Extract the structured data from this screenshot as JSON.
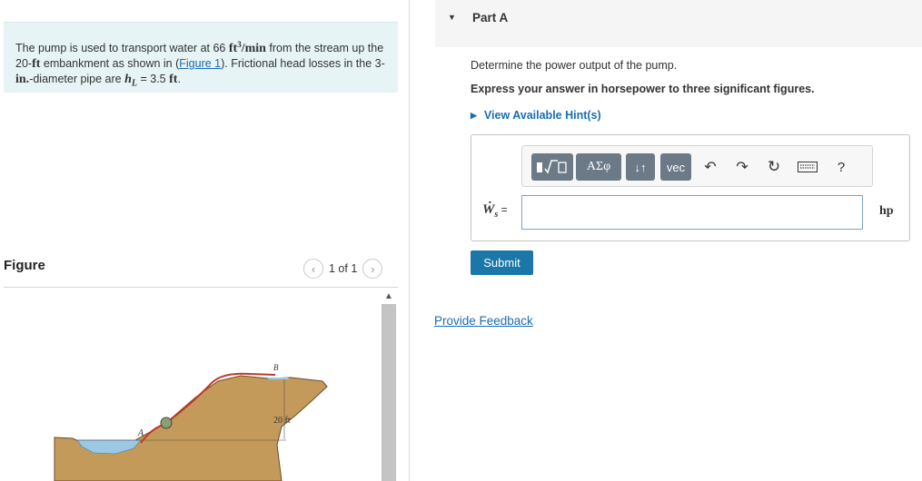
{
  "problem": {
    "text1": "The pump is used to transport water at 66 ",
    "flow_units": "ft",
    "flow_exp": "3",
    "flow_per": "/min",
    "text2": " from the stream up the 20-",
    "ft1": "ft",
    "text3": " embankment as shown in (",
    "figure_link": "Figure 1",
    "text4": "). Frictional head losses in the 3-",
    "in": "in.",
    "text5": "-diameter pipe are ",
    "hl_symbol": "h",
    "hl_sub": "L",
    "text6": " = 3.5 ",
    "ft2": "ft",
    "text7": "."
  },
  "figure": {
    "title": "Figure",
    "pager": "1 of 1",
    "label_a": "A",
    "label_b": "B",
    "dim_label": "20 ft"
  },
  "part": {
    "title": "Part A",
    "question": "Determine the power output of the pump.",
    "instruction": "Express your answer in horsepower to three significant figures.",
    "hint": "View Available Hint(s)"
  },
  "toolbar": {
    "greek": "ΑΣφ",
    "arrows": "↓↑",
    "vec": "vec",
    "help": "?"
  },
  "answer": {
    "lhs_symbol": "Ẇ",
    "lhs_sub": "s",
    "lhs_eq": " =",
    "value": "",
    "unit": "hp"
  },
  "actions": {
    "submit": "Submit",
    "feedback": "Provide Feedback"
  },
  "colors": {
    "accent": "#1b77a8",
    "link": "#1a6cb3",
    "problem_bg": "#e6f4f5",
    "toolbar_btn": "#6b7a86"
  }
}
